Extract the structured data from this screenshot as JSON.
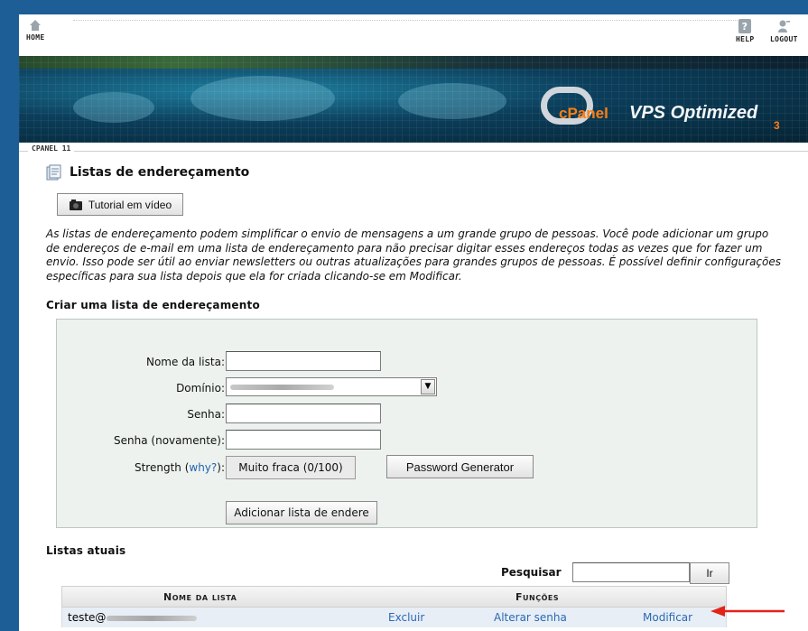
{
  "topbar": {
    "home_label": "HOME",
    "help_label": "HELP",
    "logout_label": "LOGOUT"
  },
  "banner": {
    "logo_cpanel": "cPanel",
    "logo_vps": "VPS Optimized",
    "logo_num": "3"
  },
  "breadcrumb": "CPANEL 11",
  "page": {
    "title": "Listas de endereçamento",
    "tutorial_button": "Tutorial em vídeo",
    "intro": "As listas de endereçamento podem simplificar o envio de mensagens a um grande grupo de pessoas. Você pode adicionar um grupo de endereços de e-mail em uma lista de endereçamento para não precisar digitar esses endereços todas as vezes que for fazer um envio. Isso pode ser útil ao enviar newsletters ou outras atualizações para grandes grupos de pessoas. É possível definir configurações específicas para sua lista depois que ela for criada clicando-se em Modificar."
  },
  "create_form": {
    "heading": "Criar uma lista de endereçamento",
    "list_name_label": "Nome da lista:",
    "list_name_value": "",
    "domain_label": "Domínio:",
    "password_label": "Senha:",
    "password_value": "",
    "password_again_label": "Senha (novamente):",
    "password_again_value": "",
    "strength_label": "Strength (",
    "strength_link": "why?",
    "strength_label_end": "):",
    "strength_value": "Muito fraca (0/100)",
    "generator_button": "Password Generator",
    "submit_button": "Adicionar lista de endere"
  },
  "current_lists": {
    "heading": "Listas atuais",
    "search_label": "Pesquisar",
    "search_value": "",
    "go_button": "Ir",
    "columns": [
      "Nome da lista",
      "Funções"
    ],
    "rows": [
      {
        "name_prefix": "teste@",
        "delete": "Excluir",
        "change_password": "Alterar senha",
        "modify": "Modificar"
      }
    ]
  },
  "colors": {
    "background": "#1d5e96",
    "form_bg": "#edf2ee",
    "link": "#2a6ab3",
    "arrow": "#e2231a"
  }
}
